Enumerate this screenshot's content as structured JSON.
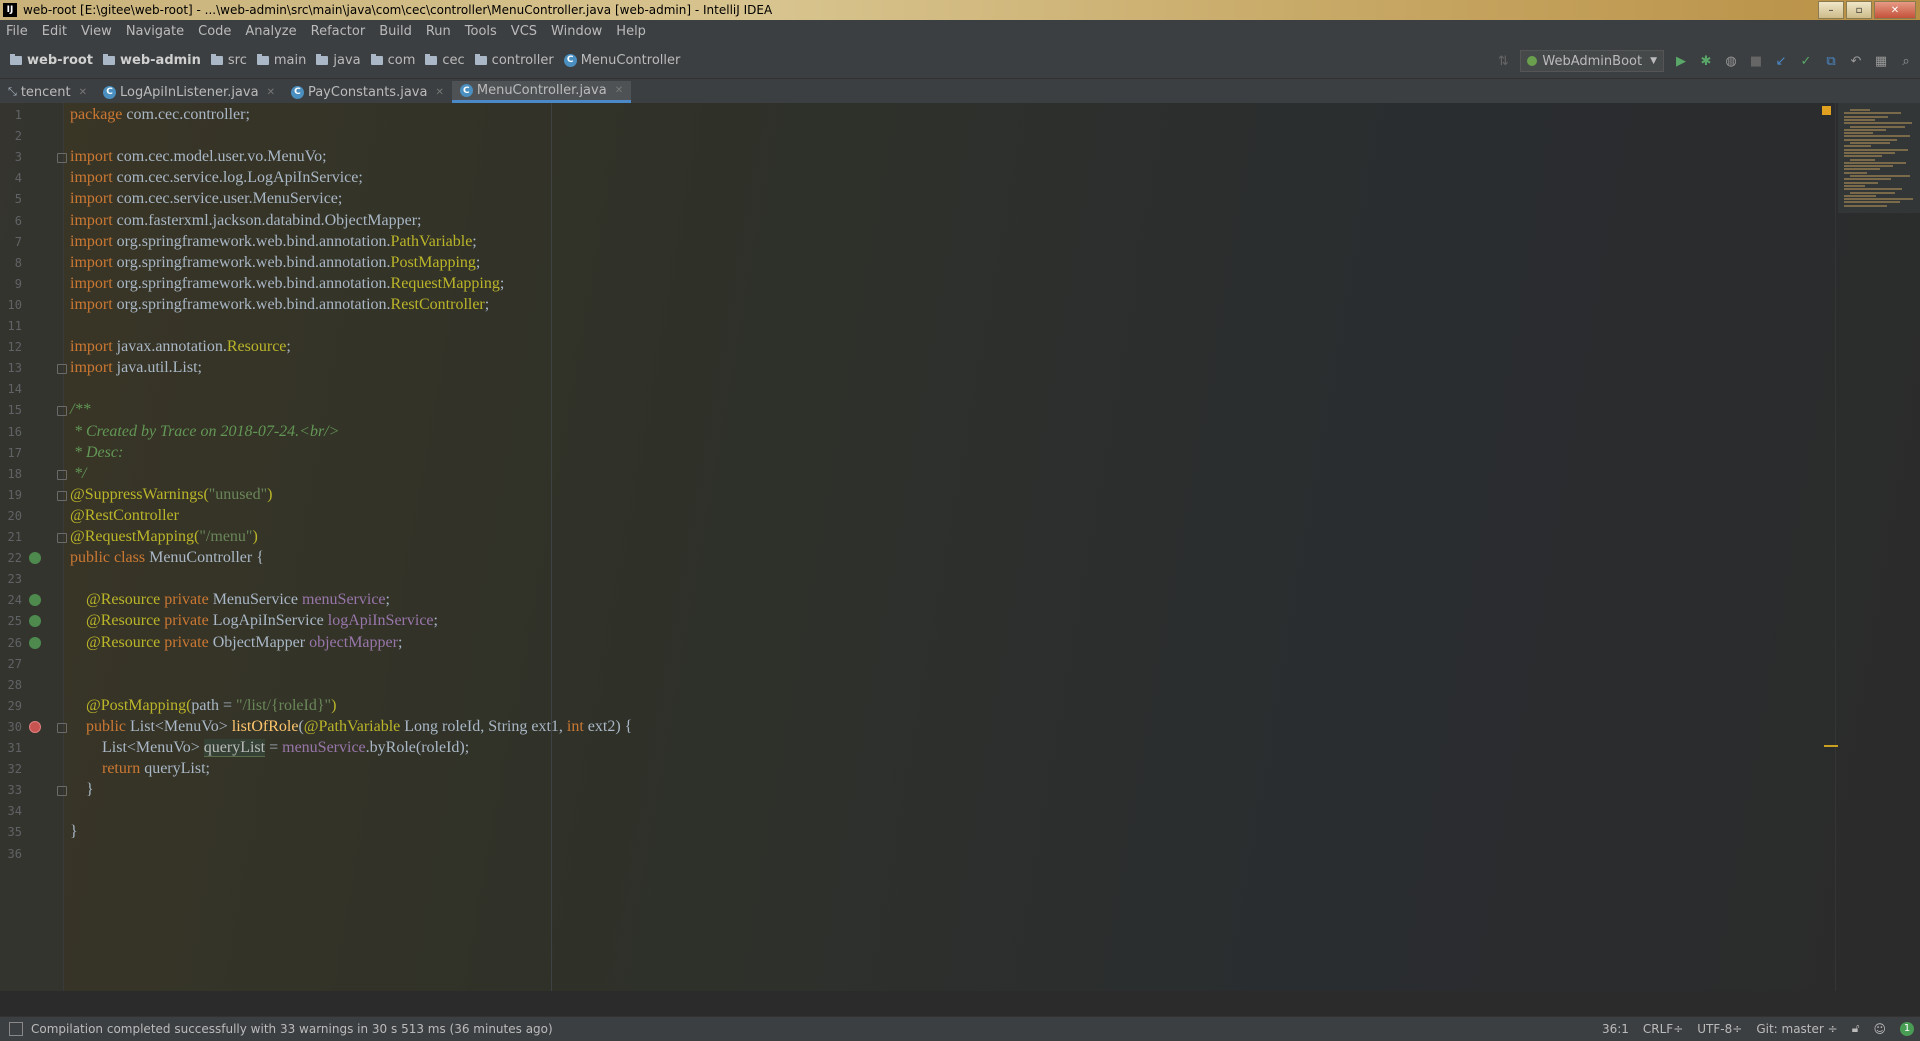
{
  "window": {
    "title": "web-root [E:\\gitee\\web-root] - ...\\web-admin\\src\\main\\java\\com\\cec\\controller\\MenuController.java [web-admin] - IntelliJ IDEA",
    "app_icon": "IJ"
  },
  "menu": [
    "File",
    "Edit",
    "View",
    "Navigate",
    "Code",
    "Analyze",
    "Refactor",
    "Build",
    "Run",
    "Tools",
    "VCS",
    "Window",
    "Help"
  ],
  "breadcrumb": [
    {
      "label": "web-root",
      "bold": true,
      "icon": "module-folder-icon"
    },
    {
      "label": "web-admin",
      "bold": true,
      "icon": "module-folder-icon"
    },
    {
      "label": "src",
      "icon": "folder-icon"
    },
    {
      "label": "main",
      "icon": "folder-icon"
    },
    {
      "label": "java",
      "icon": "folder-icon"
    },
    {
      "label": "com",
      "icon": "folder-icon"
    },
    {
      "label": "cec",
      "icon": "folder-icon"
    },
    {
      "label": "controller",
      "icon": "folder-icon"
    },
    {
      "label": "MenuController",
      "icon": "class-icon"
    }
  ],
  "run_config": "WebAdminBoot",
  "tabs": [
    {
      "label": "tencent",
      "icon": "pin-icon",
      "active": false
    },
    {
      "label": "LogApiInListener.java",
      "icon": "class-icon",
      "active": false
    },
    {
      "label": "PayConstants.java",
      "icon": "class-icon",
      "active": false
    },
    {
      "label": "MenuController.java",
      "icon": "class-icon",
      "active": true
    }
  ],
  "code_lines": [
    [
      [
        "kw",
        "package "
      ],
      [
        "pl",
        "com.cec.controller;"
      ]
    ],
    [],
    [
      [
        "kw",
        "import "
      ],
      [
        "pl",
        "com.cec.model.user.vo.MenuVo;"
      ]
    ],
    [
      [
        "kw",
        "import "
      ],
      [
        "pl",
        "com.cec.service.log.LogApiInService;"
      ]
    ],
    [
      [
        "kw",
        "import "
      ],
      [
        "pl",
        "com.cec.service.user.MenuService;"
      ]
    ],
    [
      [
        "kw",
        "import "
      ],
      [
        "pl",
        "com.fasterxml.jackson.databind.ObjectMapper;"
      ]
    ],
    [
      [
        "kw",
        "import "
      ],
      [
        "pl",
        "org.springframework.web.bind.annotation."
      ],
      [
        "an",
        "PathVariable"
      ],
      [
        "pl",
        ";"
      ]
    ],
    [
      [
        "kw",
        "import "
      ],
      [
        "pl",
        "org.springframework.web.bind.annotation."
      ],
      [
        "an",
        "PostMapping"
      ],
      [
        "pl",
        ";"
      ]
    ],
    [
      [
        "kw",
        "import "
      ],
      [
        "pl",
        "org.springframework.web.bind.annotation."
      ],
      [
        "an",
        "RequestMapping"
      ],
      [
        "pl",
        ";"
      ]
    ],
    [
      [
        "kw",
        "import "
      ],
      [
        "pl",
        "org.springframework.web.bind.annotation."
      ],
      [
        "an",
        "RestController"
      ],
      [
        "pl",
        ";"
      ]
    ],
    [],
    [
      [
        "kw",
        "import "
      ],
      [
        "pl",
        "javax.annotation."
      ],
      [
        "an",
        "Resource"
      ],
      [
        "pl",
        ";"
      ]
    ],
    [
      [
        "kw",
        "import "
      ],
      [
        "pl",
        "java.util.List;"
      ]
    ],
    [],
    [
      [
        "cm",
        "/**"
      ]
    ],
    [
      [
        "cm",
        " * Created by Trace on 2018-07-24."
      ],
      [
        "cm",
        "<br/>"
      ]
    ],
    [
      [
        "cm",
        " * Desc:"
      ]
    ],
    [
      [
        "cm",
        " */"
      ]
    ],
    [
      [
        "an",
        "@SuppressWarnings("
      ],
      [
        "st",
        "\"unused\""
      ],
      [
        "an",
        ")"
      ]
    ],
    [
      [
        "an",
        "@RestController"
      ]
    ],
    [
      [
        "an",
        "@RequestMapping("
      ],
      [
        "st",
        "\"/menu\""
      ],
      [
        "an",
        ")"
      ]
    ],
    [
      [
        "kw",
        "public class "
      ],
      [
        "pl",
        "MenuController {"
      ]
    ],
    [],
    [
      [
        "pl",
        "    "
      ],
      [
        "an",
        "@Resource "
      ],
      [
        "kw",
        "private "
      ],
      [
        "pl",
        "MenuService "
      ],
      [
        "fd",
        "menuService"
      ],
      [
        "pl",
        ";"
      ]
    ],
    [
      [
        "pl",
        "    "
      ],
      [
        "an",
        "@Resource "
      ],
      [
        "kw",
        "private "
      ],
      [
        "pl",
        "LogApiInService "
      ],
      [
        "fd",
        "logApiInService"
      ],
      [
        "pl",
        ";"
      ]
    ],
    [
      [
        "pl",
        "    "
      ],
      [
        "an",
        "@Resource "
      ],
      [
        "kw",
        "private "
      ],
      [
        "pl",
        "ObjectMapper "
      ],
      [
        "fd",
        "objectMapper"
      ],
      [
        "pl",
        ";"
      ]
    ],
    [],
    [],
    [
      [
        "pl",
        "    "
      ],
      [
        "an",
        "@PostMapping("
      ],
      [
        "pl",
        "path = "
      ],
      [
        "st",
        "\"/list/{roleId}\""
      ],
      [
        "an",
        ")"
      ]
    ],
    [
      [
        "pl",
        "    "
      ],
      [
        "kw",
        "public "
      ],
      [
        "pl",
        "List<MenuVo> "
      ],
      [
        "fn",
        "listOfRole"
      ],
      [
        "pl",
        "("
      ],
      [
        "an",
        "@PathVariable "
      ],
      [
        "pl",
        "Long roleId, String ext1, "
      ],
      [
        "kw",
        "int "
      ],
      [
        "pl",
        "ext2) {"
      ]
    ],
    [
      [
        "pl",
        "        List<MenuVo> "
      ],
      [
        "hl",
        "queryList"
      ],
      [
        "pl",
        " = "
      ],
      [
        "fd",
        "menuService"
      ],
      [
        "pl",
        ".byRole(roleId);"
      ]
    ],
    [
      [
        "pl",
        "        "
      ],
      [
        "kw",
        "return "
      ],
      [
        "pl",
        "queryList;"
      ]
    ],
    [
      [
        "pl",
        "    }"
      ]
    ],
    [],
    [
      [
        "pl",
        "}"
      ]
    ],
    []
  ],
  "line_numbers": [
    "1",
    "2",
    "3",
    "4",
    "5",
    "6",
    "7",
    "8",
    "9",
    "10",
    "11",
    "12",
    "13",
    "14",
    "15",
    "16",
    "17",
    "18",
    "19",
    "20",
    "21",
    "22",
    "23",
    "24",
    "25",
    "26",
    "27",
    "28",
    "29",
    "30",
    "31",
    "32",
    "33",
    "34",
    "35",
    "36"
  ],
  "status": {
    "message": "Compilation completed successfully with 33 warnings in 30 s 513 ms (36 minutes ago)",
    "position": "36:1",
    "line_sep": "CRLF÷",
    "encoding": "UTF-8÷",
    "git": "Git: master ÷",
    "event_count": "1"
  },
  "colors": {
    "accent": "#4a88c7",
    "keyword": "#cc7832",
    "annotation": "#bbb529",
    "string": "#6a8759",
    "comment": "#629755",
    "field": "#9876aa",
    "method": "#ffc66d"
  }
}
